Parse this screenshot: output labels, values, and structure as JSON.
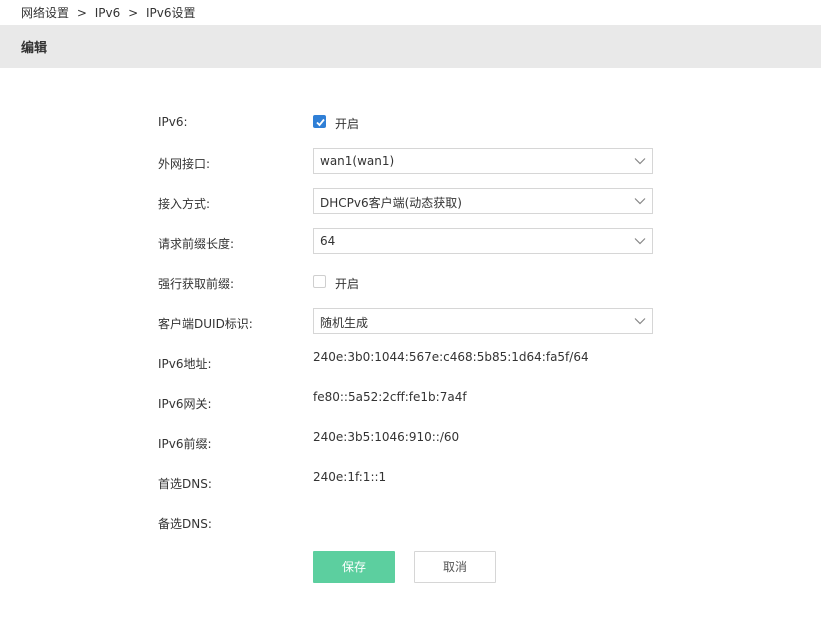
{
  "breadcrumb": {
    "items": [
      "网络设置",
      "IPv6",
      "IPv6设置"
    ],
    "separator": ">"
  },
  "header": {
    "title": "编辑"
  },
  "form": {
    "ipv6": {
      "label": "IPv6:",
      "checkbox_label": "开启",
      "checked": true
    },
    "wan_interface": {
      "label": "外网接口:",
      "value": "wan1(wan1)"
    },
    "access_mode": {
      "label": "接入方式:",
      "value": "DHCPv6客户端(动态获取)"
    },
    "prefix_length": {
      "label": "请求前缀长度:",
      "value": "64"
    },
    "force_prefix": {
      "label": "强行获取前缀:",
      "checkbox_label": "开启",
      "checked": false
    },
    "duid": {
      "label": "客户端DUID标识:",
      "value": "随机生成"
    },
    "ipv6_address": {
      "label": "IPv6地址:",
      "value": "240e:3b0:1044:567e:c468:5b85:1d64:fa5f/64"
    },
    "ipv6_gateway": {
      "label": "IPv6网关:",
      "value": "fe80::5a52:2cff:fe1b:7a4f"
    },
    "ipv6_prefix": {
      "label": "IPv6前缀:",
      "value": "240e:3b5:1046:910::/60"
    },
    "primary_dns": {
      "label": "首选DNS:",
      "value": "240e:1f:1::1"
    },
    "secondary_dns": {
      "label": "备选DNS:",
      "value": ""
    }
  },
  "buttons": {
    "save": "保存",
    "cancel": "取消"
  },
  "colors": {
    "checkbox_checked": "#2f7fd6",
    "save_button": "#5ccf9f",
    "header_bar": "#e9e9e9"
  },
  "icons": {
    "select_arrow": "chevron-down-icon",
    "checkmark": "check-icon"
  }
}
